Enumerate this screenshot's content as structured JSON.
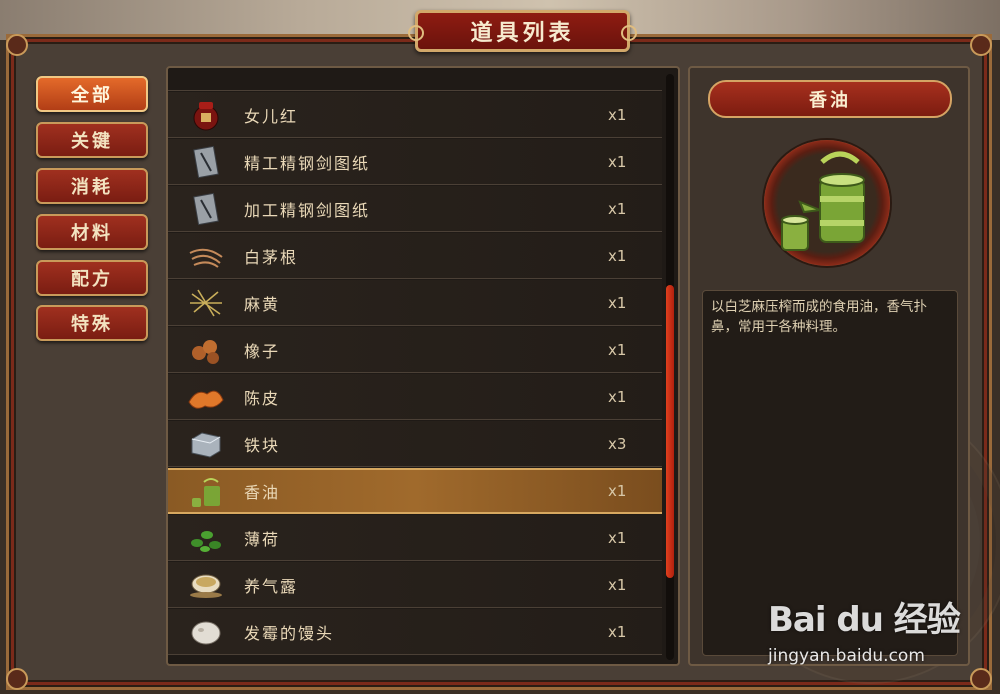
{
  "window": {
    "title": "道具列表"
  },
  "categories": [
    {
      "label": "全部",
      "active": true
    },
    {
      "label": "关键",
      "active": false
    },
    {
      "label": "消耗",
      "active": false
    },
    {
      "label": "材料",
      "active": false
    },
    {
      "label": "配方",
      "active": false
    },
    {
      "label": "特殊",
      "active": false
    }
  ],
  "items": [
    {
      "name": "女儿红",
      "qty": "x1",
      "icon": "wine-jar-icon"
    },
    {
      "name": "精工精钢剑图纸",
      "qty": "x1",
      "icon": "blueprint-scroll-icon"
    },
    {
      "name": "加工精钢剑图纸",
      "qty": "x1",
      "icon": "blueprint-scroll-icon"
    },
    {
      "name": "白茅根",
      "qty": "x1",
      "icon": "root-herb-icon"
    },
    {
      "name": "麻黄",
      "qty": "x1",
      "icon": "straw-herb-icon"
    },
    {
      "name": "橡子",
      "qty": "x1",
      "icon": "acorn-icon"
    },
    {
      "name": "陈皮",
      "qty": "x1",
      "icon": "orange-peel-icon"
    },
    {
      "name": "铁块",
      "qty": "x3",
      "icon": "iron-ingot-icon"
    },
    {
      "name": "香油",
      "qty": "x1",
      "icon": "oil-teapot-icon",
      "selected": true
    },
    {
      "name": "薄荷",
      "qty": "x1",
      "icon": "mint-leaf-icon"
    },
    {
      "name": "养气露",
      "qty": "x1",
      "icon": "tea-bowl-icon"
    },
    {
      "name": "发霉的馒头",
      "qty": "x1",
      "icon": "steamed-bun-icon"
    }
  ],
  "scrollbar": {
    "position": 0.72,
    "thumb_fraction": 0.5
  },
  "detail": {
    "name": "香油",
    "icon": "oil-teapot-icon",
    "description": "以白芝麻压榨而成的食用油，香气扑鼻，常用于各种料理。"
  },
  "watermark": {
    "brand": "Bai du 经验",
    "url": "jingyan.baidu.com"
  },
  "colors": {
    "accent_red": "#8e1c12",
    "gold_border": "#d2a86a",
    "selected_row": "#a06a2c",
    "scroll_thumb": "#e0401e"
  }
}
